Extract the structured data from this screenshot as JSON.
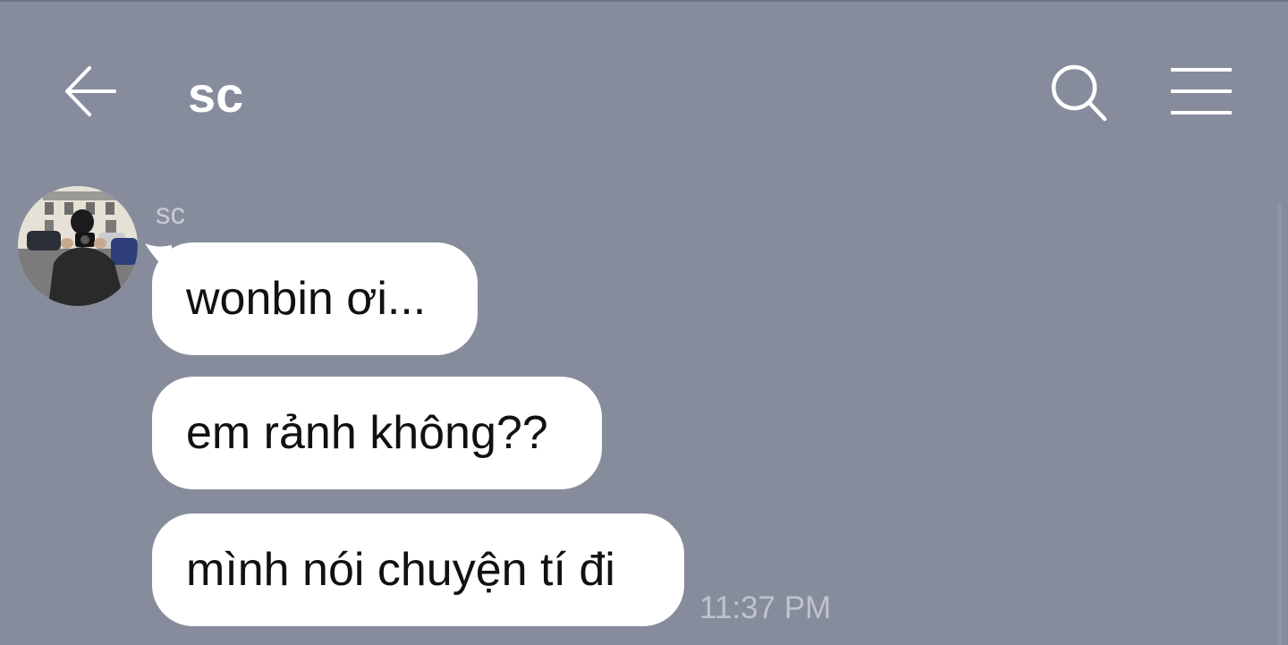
{
  "header": {
    "title": "sc",
    "back_icon": "arrow-left-icon",
    "search_icon": "search-icon",
    "menu_icon": "hamburger-menu-icon"
  },
  "conversation": {
    "sender": "sc",
    "avatar_icon": "profile-photo",
    "messages": [
      {
        "text": "wonbin ơi..."
      },
      {
        "text": "em rảnh không??"
      },
      {
        "text": "mình nói chuyện tí đi"
      }
    ],
    "last_time": "11:37 PM"
  },
  "colors": {
    "background": "#868c9c",
    "bubble": "#ffffff",
    "header_text": "#ffffff",
    "muted_text": "#c6cad3"
  }
}
